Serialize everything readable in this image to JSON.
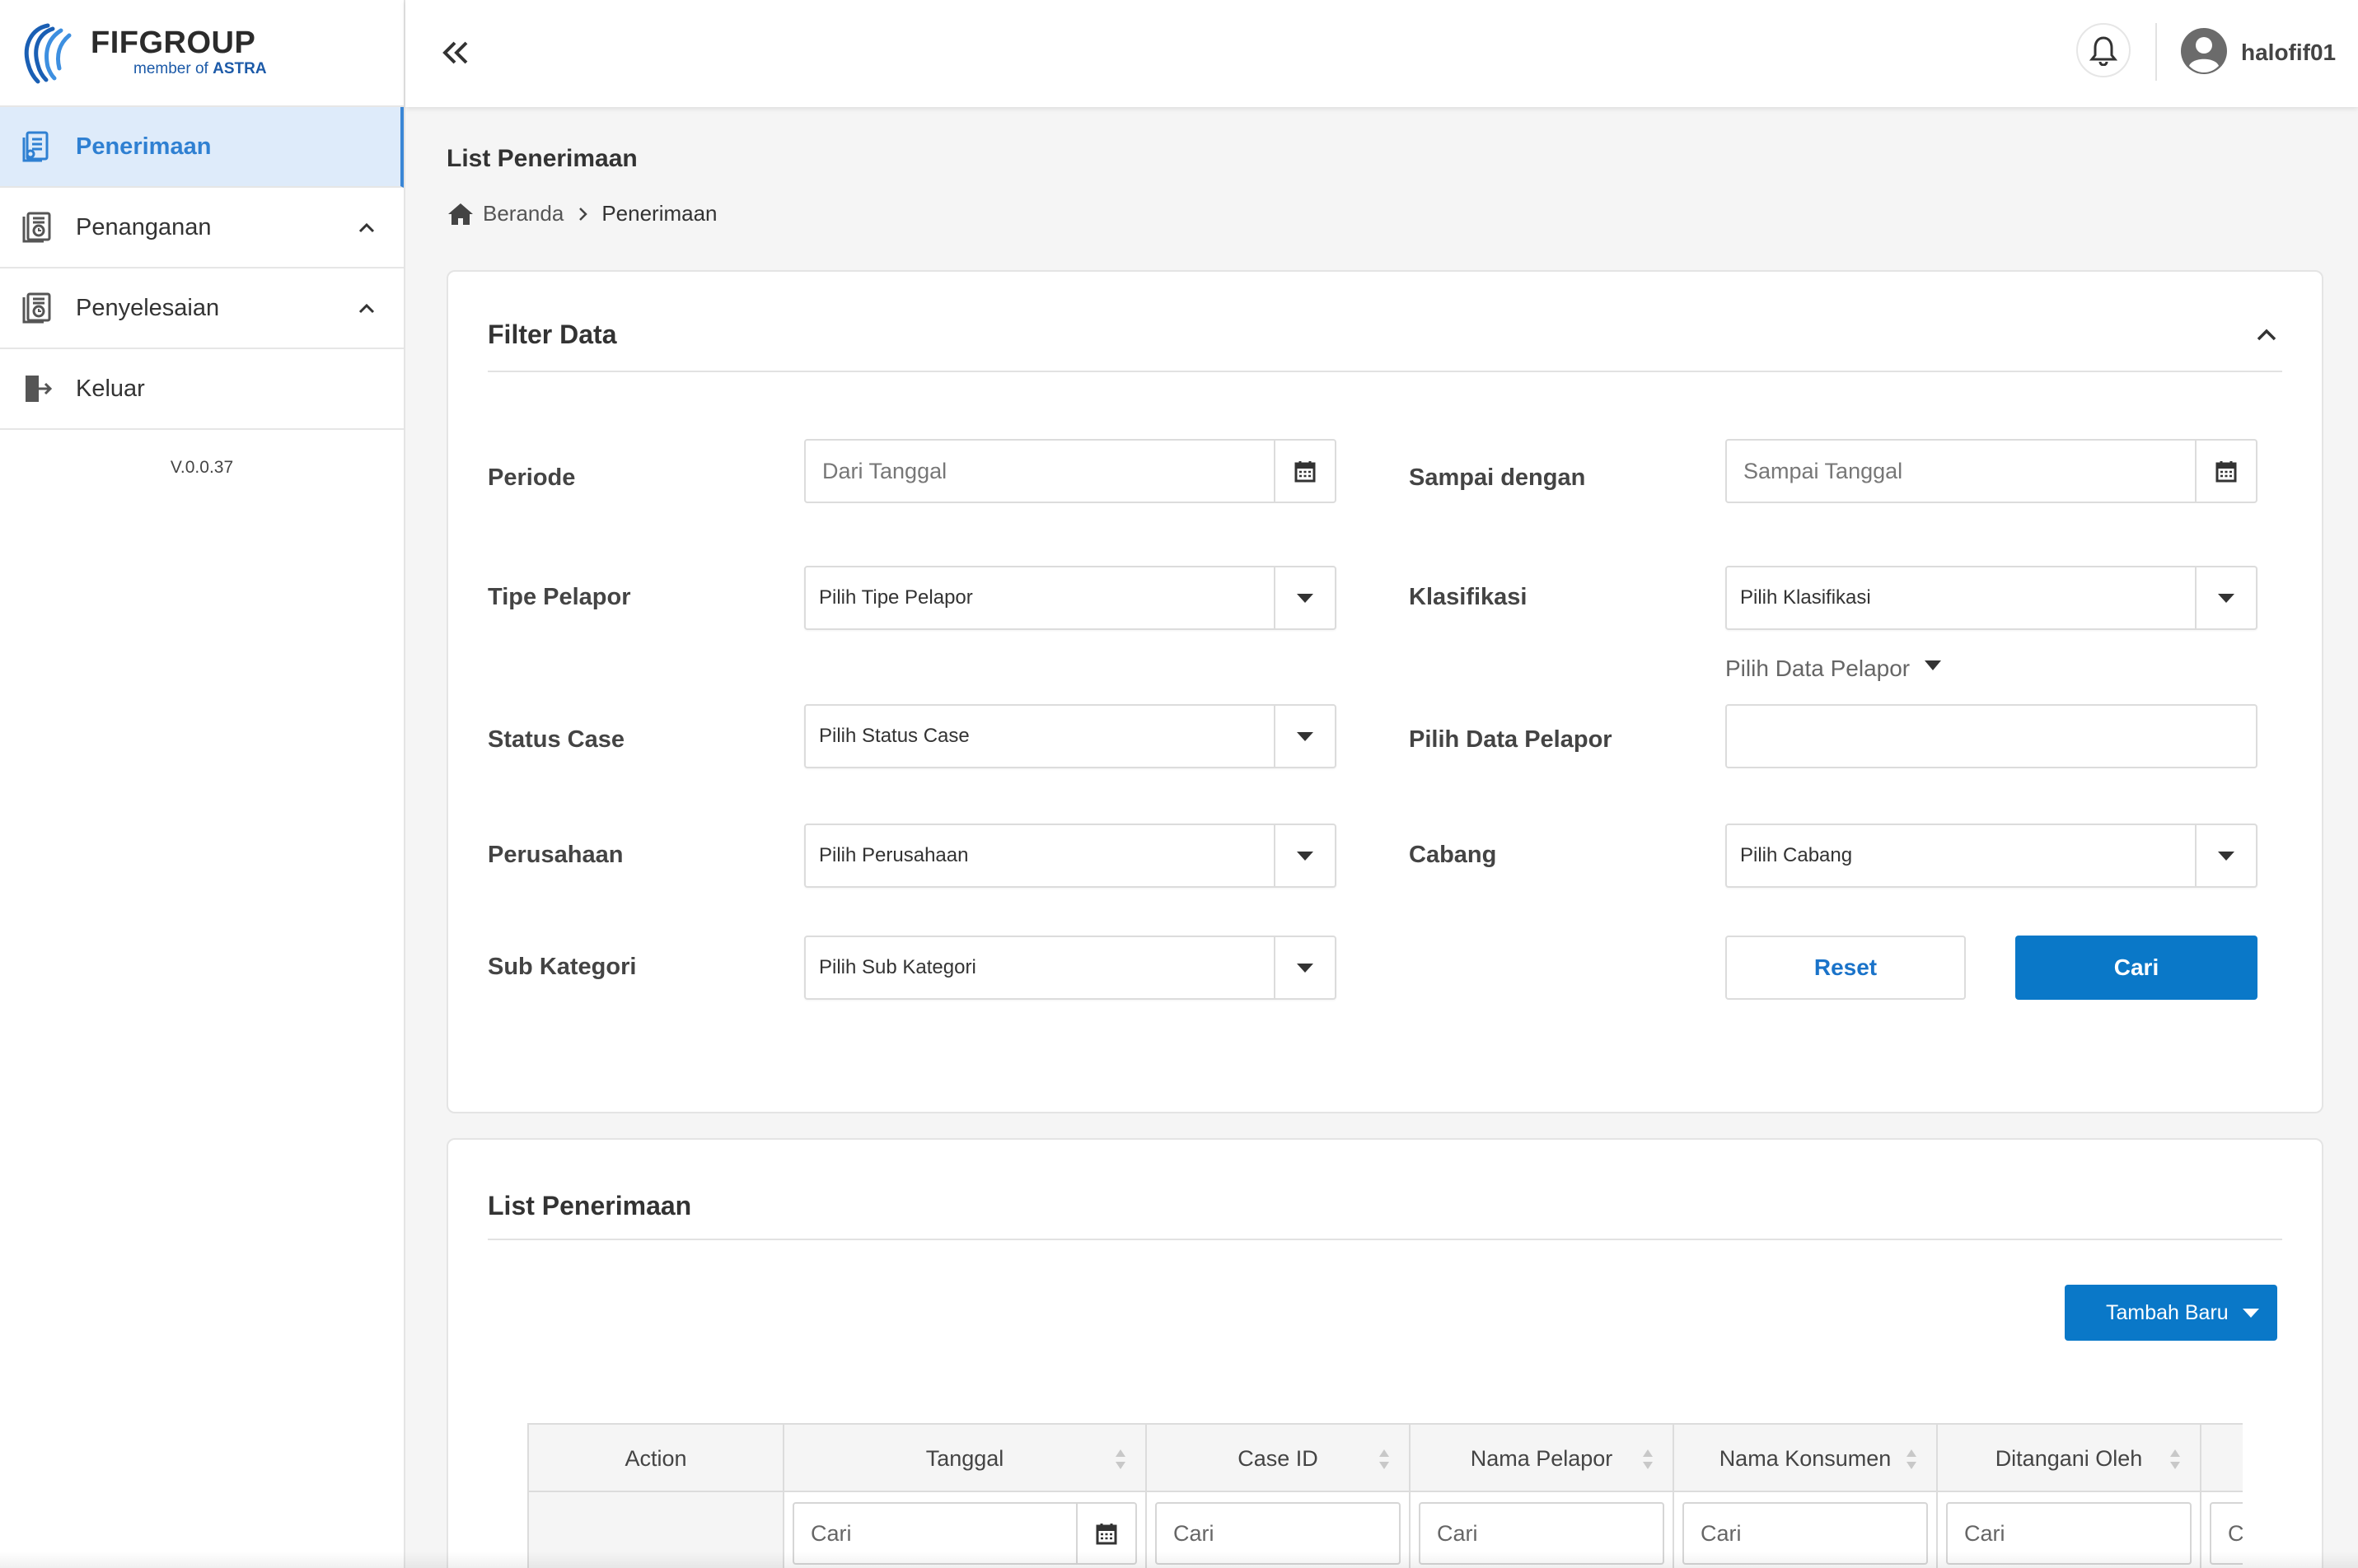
{
  "brand": {
    "name": "FIFGROUP",
    "tagline_prefix": "member of",
    "tagline_brand": "ASTRA",
    "primary_color": "#0a78c8",
    "active_color": "#2f80d2"
  },
  "sidebar": {
    "items": [
      {
        "label": "Penerimaan",
        "icon": "document-list-icon",
        "active": true
      },
      {
        "label": "Penanganan",
        "icon": "document-clock-icon",
        "expandable": true
      },
      {
        "label": "Penyelesaian",
        "icon": "document-clock-icon",
        "expandable": true
      },
      {
        "label": "Keluar",
        "icon": "logout-icon"
      }
    ],
    "version": "V.0.0.37"
  },
  "topbar": {
    "username": "halofif01"
  },
  "page": {
    "title": "List Penerimaan",
    "breadcrumb": [
      "Beranda",
      "Penerimaan"
    ]
  },
  "filter": {
    "title": "Filter Data",
    "periode_label": "Periode",
    "periode_from_placeholder": "Dari Tanggal",
    "sampai_label": "Sampai dengan",
    "sampai_placeholder": "Sampai Tanggal",
    "tipe_pelapor_label": "Tipe Pelapor",
    "tipe_pelapor_value": "Pilih Tipe Pelapor",
    "klasifikasi_label": "Klasifikasi",
    "klasifikasi_value": "Pilih Klasifikasi",
    "pelapor_hint": "Pilih Data Pelapor",
    "status_case_label": "Status Case",
    "status_case_value": "Pilih Status Case",
    "data_pelapor_label": "Pilih Data Pelapor",
    "data_pelapor_value": "",
    "perusahaan_label": "Perusahaan",
    "perusahaan_value": "Pilih Perusahaan",
    "cabang_label": "Cabang",
    "cabang_value": "Pilih Cabang",
    "sub_kategori_label": "Sub Kategori",
    "sub_kategori_value": "Pilih Sub Kategori",
    "reset_label": "Reset",
    "cari_label": "Cari"
  },
  "list": {
    "title": "List Penerimaan",
    "add_label": "Tambah Baru",
    "columns": [
      "Action",
      "Tanggal",
      "Case ID",
      "Nama Pelapor",
      "Nama Konsumen",
      "Ditangani Oleh"
    ],
    "search_placeholder": "Cari",
    "search_placeholder_cut": "C"
  }
}
